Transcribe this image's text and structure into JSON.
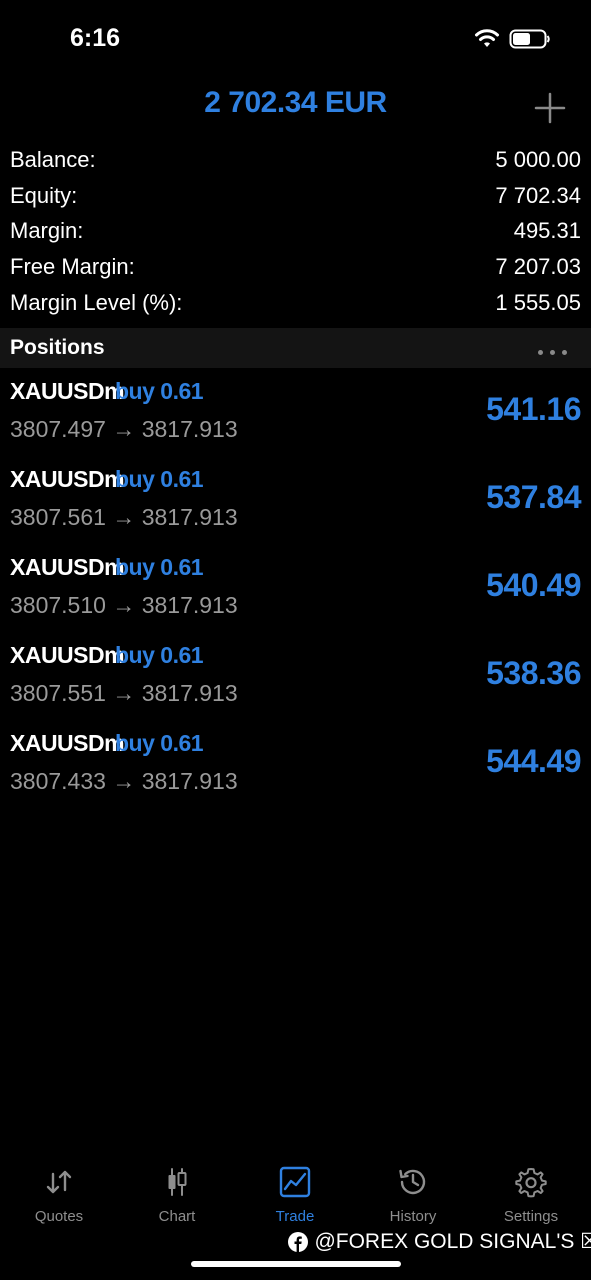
{
  "status_bar": {
    "time": "6:16"
  },
  "header": {
    "balance_title": "2 702.34 EUR"
  },
  "summary": [
    {
      "label": "Balance:",
      "value": "5 000.00"
    },
    {
      "label": "Equity:",
      "value": "7 702.34"
    },
    {
      "label": "Margin:",
      "value": "495.31"
    },
    {
      "label": "Free Margin:",
      "value": "7 207.03"
    },
    {
      "label": "Margin Level (%):",
      "value": "1 555.05"
    }
  ],
  "positions_section": {
    "title": "Positions"
  },
  "positions": [
    {
      "symbol": "XAUUSDm",
      "side": "buy 0.61",
      "prices": "3807.497 → 3817.913",
      "profit": "541.16"
    },
    {
      "symbol": "XAUUSDm",
      "side": "buy 0.61",
      "prices": "3807.561 → 3817.913",
      "profit": "537.84"
    },
    {
      "symbol": "XAUUSDm",
      "side": "buy 0.61",
      "prices": "3807.510 → 3817.913",
      "profit": "540.49"
    },
    {
      "symbol": "XAUUSDm",
      "side": "buy 0.61",
      "prices": "3807.551 → 3817.913",
      "profit": "538.36"
    },
    {
      "symbol": "XAUUSDm",
      "side": "buy 0.61",
      "prices": "3807.433 → 3817.913",
      "profit": "544.49"
    }
  ],
  "tabs": [
    {
      "label": "Quotes",
      "icon": "quotes-arrows-icon",
      "active": false
    },
    {
      "label": "Chart",
      "icon": "candlestick-icon",
      "active": false
    },
    {
      "label": "Trade",
      "icon": "trade-chart-icon",
      "active": true
    },
    {
      "label": "History",
      "icon": "history-clock-icon",
      "active": false
    },
    {
      "label": "Settings",
      "icon": "gear-icon",
      "active": false
    }
  ],
  "watermark": {
    "text": "@FOREX GOLD SIGNAL'S ☒"
  },
  "colors": {
    "accent": "#2f80e0",
    "background": "#000000",
    "muted": "#8e8e8e"
  }
}
